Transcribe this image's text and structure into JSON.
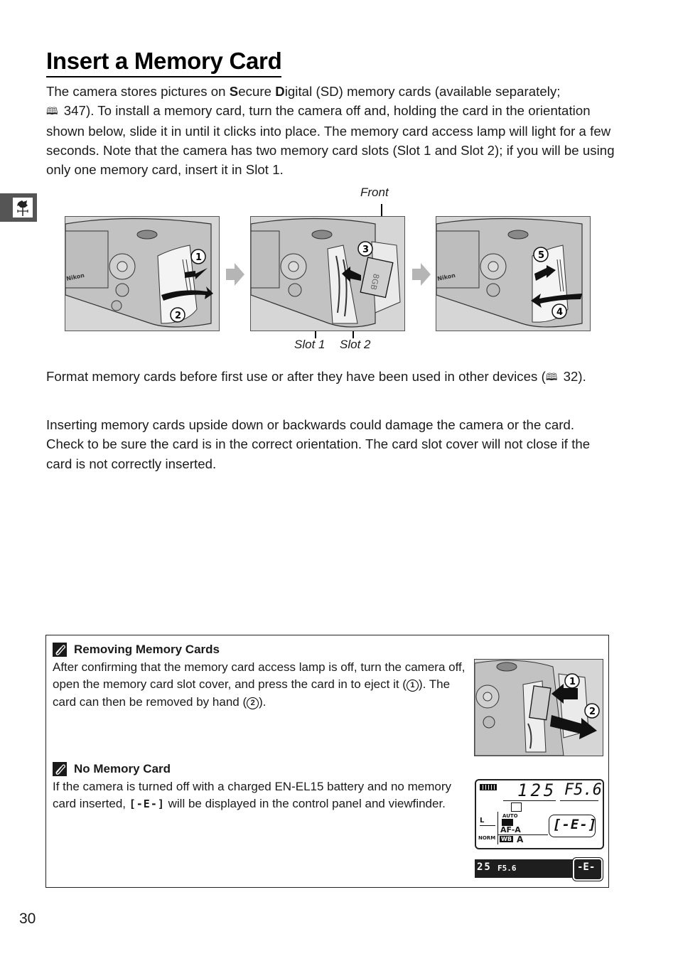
{
  "page": {
    "title": "Insert a Memory Card",
    "page_number": "30",
    "side_tab_icon": "weathervane-rooster-icon"
  },
  "intro": {
    "text_a": "The camera stores pictures on ",
    "bold_s": "S",
    "text_b": "ecure ",
    "bold_d": "D",
    "text_c": "igital (SD) memory cards (available separately;",
    "ref_icon": "book-reference-icon",
    "text_d": " 347).  To install a memory card, turn the camera off and, holding the card in the orientation shown below, slide it in until it clicks into place.  The memory card access lamp will light for a few seconds.  Note that the camera has two memory card slots (Slot 1 and Slot 2); if you will be using only one memory card, insert it in Slot 1."
  },
  "figure": {
    "labels": {
      "front": "Front",
      "slot1": "Slot 1",
      "slot2": "Slot 2"
    },
    "steps": [
      "1",
      "2",
      "3",
      "4",
      "5"
    ],
    "brand": "Nikon",
    "card_text": "8GB"
  },
  "format_note": {
    "text_a": "Format memory cards before first use or after they have been used in other devices (",
    "text_b": " 32)."
  },
  "warning": {
    "text": "Inserting memory cards upside down or backwards could damage the camera or the card.  Check to be sure the card is in the correct orientation.  The card slot cover will not close if the card is not correctly inserted."
  },
  "notes": [
    {
      "icon": "paperclip-note-icon",
      "heading": "Removing Memory Cards",
      "text_a": "After confirming that the memory card access lamp is off, turn the camera off, open the memory card slot cover, and press the card in to eject it (",
      "step1": "1",
      "text_b": ").  The card can then be removed by hand (",
      "step2": "2",
      "text_c": ")."
    },
    {
      "icon": "paperclip-note-icon",
      "heading": "No Memory Card",
      "text_a": "If the camera is turned off with a charged EN-EL15 battery and no memory card inserted, ",
      "lcd_symbol": "[-E-]",
      "text_b": " will be displayed in the control panel and viewfinder."
    }
  ],
  "control_panel": {
    "shutter": "125",
    "aperture": "F5.6",
    "image_size": "L",
    "quality": "NORM",
    "af_mode": "AF-A",
    "wb_label": "WB",
    "wb_value": "A",
    "iso_auto": "AUTO",
    "card_display": "[-E-]"
  },
  "viewfinder": {
    "shutter": "25",
    "aperture": "F5.6",
    "card_display": "-E-"
  }
}
